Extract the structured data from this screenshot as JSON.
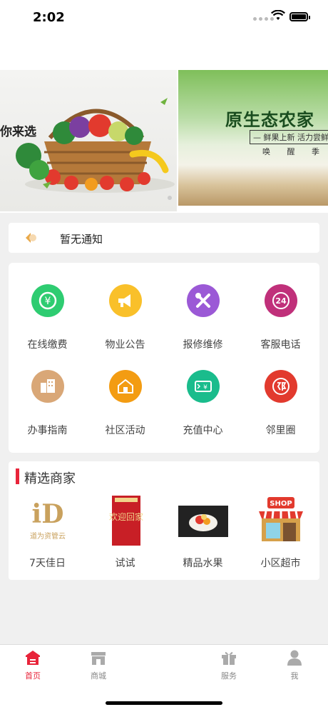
{
  "status": {
    "time": "2:02"
  },
  "banner": {
    "slide1_text": "你来选",
    "slide2_title": "原生态农家",
    "slide2_sub": "— 鲜果上新 活力尝鲜",
    "slide2_sub2": "唤 醒 季 /"
  },
  "notice": {
    "text": "暂无通知"
  },
  "services": [
    {
      "label": "在线缴费",
      "color": "#2ecc71",
      "icon": "payment-icon",
      "glyph": "¥"
    },
    {
      "label": "物业公告",
      "color": "#f9c02a",
      "icon": "megaphone-icon",
      "glyph": "📢"
    },
    {
      "label": "报修维修",
      "color": "#9b59d6",
      "icon": "tools-icon",
      "glyph": "✕"
    },
    {
      "label": "客服电话",
      "color": "#c0307a",
      "icon": "phone-24-icon",
      "glyph": "24"
    },
    {
      "label": "办事指南",
      "color": "#d9a777",
      "icon": "buildings-icon",
      "glyph": "▦"
    },
    {
      "label": "社区活动",
      "color": "#f39c12",
      "icon": "community-house-icon",
      "glyph": "⌂"
    },
    {
      "label": "充值中心",
      "color": "#1abc8c",
      "icon": "recharge-card-icon",
      "glyph": "¥"
    },
    {
      "label": "邻里圈",
      "color": "#e23a2e",
      "icon": "neighbor-circle-icon",
      "glyph": "邻"
    }
  ],
  "merchants": {
    "title": "精选商家",
    "items": [
      {
        "label": "7天佳日",
        "logo_text": "道为资管云"
      },
      {
        "label": "试试",
        "logo_text": "欢迎回家"
      },
      {
        "label": "精品水果",
        "logo_text": ""
      },
      {
        "label": "小区超市",
        "logo_text": "SHOP"
      }
    ]
  },
  "tabbar": [
    {
      "label": "首页",
      "icon": "home-icon",
      "active": true
    },
    {
      "label": "商城",
      "icon": "store-icon",
      "active": false
    },
    {
      "label": "服务",
      "icon": "gift-icon",
      "active": false
    },
    {
      "label": "我",
      "icon": "user-icon",
      "active": false
    }
  ],
  "colors": {
    "accent": "#e8243a"
  }
}
